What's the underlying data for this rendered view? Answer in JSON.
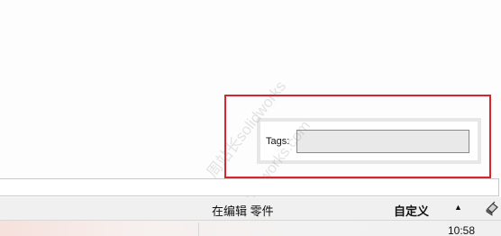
{
  "tags_panel": {
    "label": "Tags:",
    "input_value": ""
  },
  "status_bar": {
    "mode_text": "在编辑 零件",
    "units_text": "自定义",
    "arrow_glyph": "▲",
    "icon": "rebuild-stamp-icon"
  },
  "taskbar": {
    "clock_text": "10:58"
  },
  "watermark": {
    "line1": "周站长solidworks",
    "line2": "zzzsolidworks.com"
  },
  "colors": {
    "highlight_border": "#d9242e",
    "panel_bg": "#e7e7e7",
    "input_bg": "#e9e9e9"
  }
}
